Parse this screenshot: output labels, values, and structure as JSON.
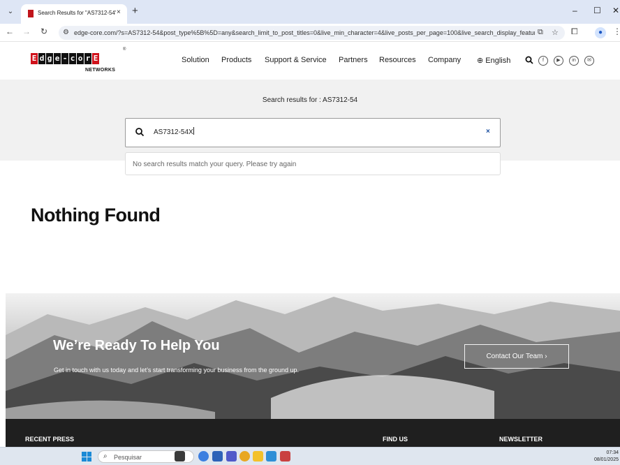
{
  "browser": {
    "tab_title": "Search Results for \"AS7312-54\"",
    "tab_close": "×",
    "new_tab": "+",
    "url": "edge-core.com/?s=AS7312-54&post_type%5B%5D=any&search_limit_to_post_titles=0&live_min_character=4&live_posts_per_page=100&live_search_display_feature...",
    "window_controls": {
      "minimize": "–",
      "maximize": "☐",
      "close": "✕"
    }
  },
  "site": {
    "logo_letters": [
      "E",
      "d",
      "g",
      "e",
      "-",
      "c",
      "o",
      "r",
      "E"
    ],
    "logo_sub": "NETWORKS",
    "logo_reg": "®",
    "nav": [
      "Solution",
      "Products",
      "Support & Service",
      "Partners",
      "Resources",
      "Company"
    ],
    "language": "English",
    "social_icons": [
      "facebook-icon",
      "youtube-icon",
      "linkedin-icon",
      "email-icon"
    ]
  },
  "search": {
    "results_for": "Search results for : AS7312-54",
    "query": "AS7312-54X",
    "clear": "×",
    "no_results": "No search results match your query. Please try again"
  },
  "main": {
    "heading": "Nothing Found"
  },
  "hero": {
    "title": "We’re Ready To Help You",
    "subtitle": "Get in touch with us today and let’s start transforming your business from the ground up.",
    "button": "Contact Our Team  ›"
  },
  "footer": {
    "recent_press": "RECENT PRESS",
    "find_us": "FIND US",
    "newsletter": "NEWSLETTER"
  },
  "taskbar": {
    "search_placeholder": "Pesquisar",
    "time": "07:34",
    "date": "08/01/2025",
    "accent": "#1b8ad6"
  }
}
